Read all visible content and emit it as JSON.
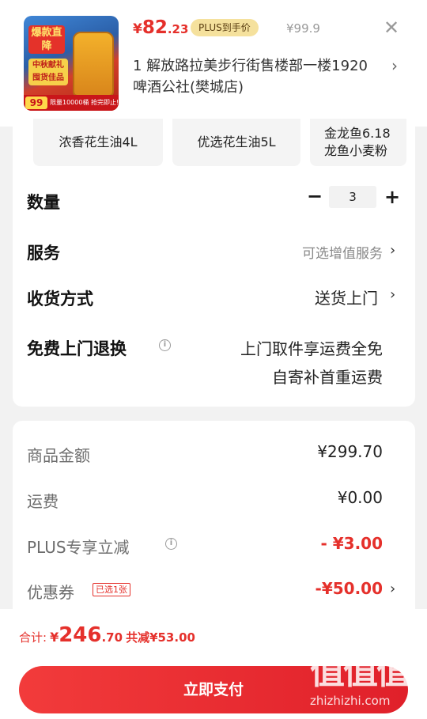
{
  "product": {
    "thumb": {
      "badge_top": "爆款直降",
      "badge_mid": "中秋献礼 囤货佳品",
      "price_chip": "99",
      "promo_text": "限量10000桶 抢完即止!"
    },
    "currency": "¥",
    "price_int": "82",
    "price_dec": ".23",
    "plus_badge": "PLUS到手价",
    "original_price": "¥99.9",
    "store": "1 解放路拉美步行街售楼部一楼1920啤酒公社(樊城店)"
  },
  "variants": [
    "浓香花生油4L",
    "优选花生油5L",
    "金龙鱼6.18 龙鱼小麦粉"
  ],
  "quantity": {
    "label": "数量",
    "value": "3",
    "minus": "−",
    "plus": "+"
  },
  "service": {
    "label": "服务",
    "value": "可选增值服务"
  },
  "delivery": {
    "label": "收货方式",
    "value": "送货上门"
  },
  "return": {
    "label": "免费上门退换",
    "line1": "上门取件享运费全免",
    "line2": "自寄补首重运费"
  },
  "price_detail": {
    "goods_label": "商品金额",
    "goods_value": "¥299.70",
    "shipping_label": "运费",
    "shipping_value": "¥0.00",
    "plus_label": "PLUS专享立减",
    "plus_value": "- ¥3.00",
    "coupon_label": "优惠券",
    "coupon_tag": "已选1张",
    "coupon_value": "-¥50.00"
  },
  "total": {
    "label": "合计:",
    "currency": "¥",
    "int": "246",
    "dec": ".70",
    "save": "共减¥53.00"
  },
  "pay_button": "立即支付",
  "watermark": {
    "big": "值值值",
    "small": "zhizhizhi.com"
  },
  "colors": {
    "accent_red": "#e5302b",
    "plus_gold": "#f5e19d"
  },
  "icons": {
    "close": "close-icon",
    "chevron": "chevron-right-icon",
    "info": "info-icon"
  }
}
